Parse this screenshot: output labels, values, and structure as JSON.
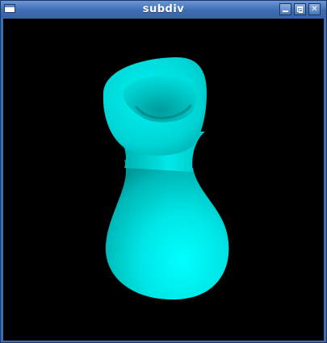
{
  "window": {
    "title": "subdiv",
    "controls": {
      "minimize": "minimize-icon",
      "maximize": "maximize-icon",
      "close": "close-icon"
    }
  },
  "viewport": {
    "background": "#000000",
    "object": {
      "shape": "vase",
      "color": "#00ffff",
      "shade_color": "#009a9a"
    }
  }
}
